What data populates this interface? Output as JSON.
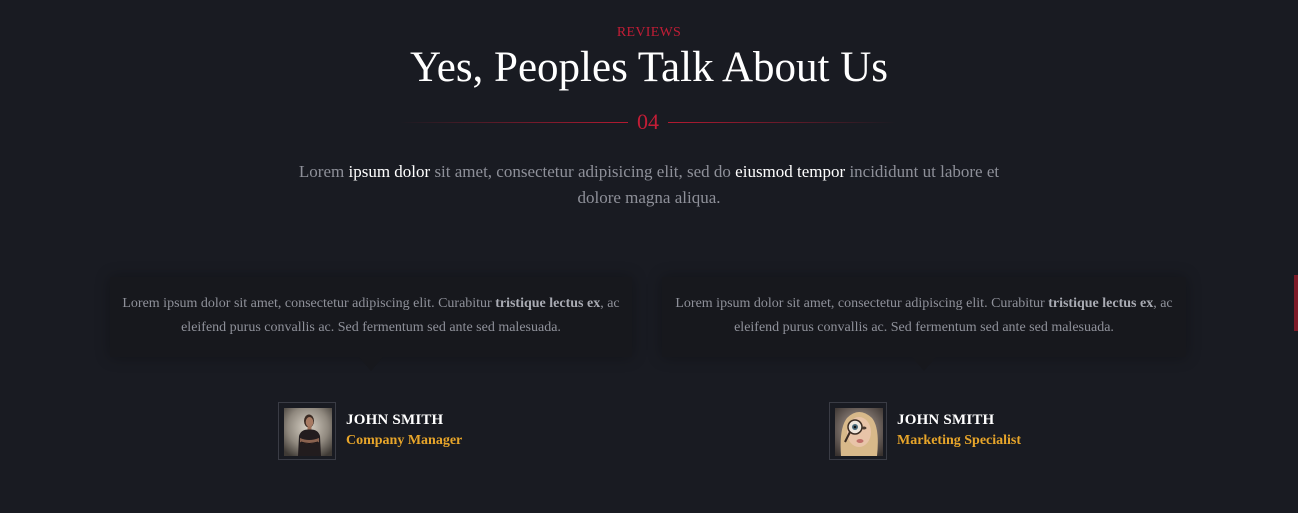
{
  "section": {
    "label": "REVIEWS",
    "title": "Yes, Peoples Talk About Us",
    "number": "04",
    "intro": [
      {
        "text": "Lorem ",
        "highlight": false
      },
      {
        "text": "ipsum dolor",
        "highlight": true
      },
      {
        "text": " sit amet, consectetur adipisicing elit, sed do ",
        "highlight": false
      },
      {
        "text": "eiusmod tempor",
        "highlight": true
      },
      {
        "text": " incididunt ut labore et dolore magna aliqua.",
        "highlight": false
      }
    ]
  },
  "reviews": [
    {
      "text_before": "Lorem ipsum dolor sit amet, consectetur adipiscing elit. Curabitur ",
      "text_bold": "tristique lectus ex",
      "text_after": ", ac eleifend purus convallis ac. Sed fermentum sed ante sed malesuada.",
      "author_name": "JOHN SMITH",
      "author_role": "Company Manager"
    },
    {
      "text_before": "Lorem ipsum dolor sit amet, consectetur adipiscing elit. Curabitur ",
      "text_bold": "tristique lectus ex",
      "text_after": ", ac eleifend purus convallis ac. Sed fermentum sed ante sed malesuada.",
      "author_name": "JOHN SMITH",
      "author_role": "Marketing Specialist"
    }
  ],
  "colors": {
    "background": "#191b22",
    "accent_red": "#c21d36",
    "accent_gold": "#e7a52a",
    "card": "#17181d"
  }
}
